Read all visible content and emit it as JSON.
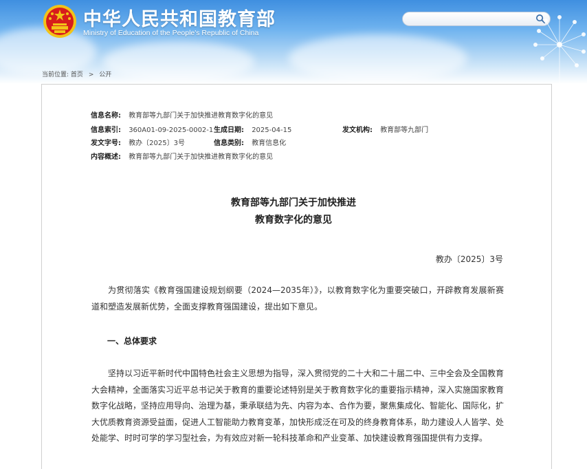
{
  "header": {
    "site_title": "中华人民共和国教育部",
    "site_subtitle": "Ministry of Education of the People's Republic of China",
    "search_placeholder": "",
    "colors": {
      "sky_top": "#3f8fe0",
      "sky_bottom": "#ffffff",
      "emblem_red": "#d71c1c",
      "emblem_gold": "#f2c318"
    },
    "icons": {
      "emblem": "national-emblem-icon",
      "search": "search-icon"
    }
  },
  "breadcrumb": {
    "prefix": "当前位置:",
    "items": [
      "首页",
      "公开"
    ],
    "separator": ">"
  },
  "meta": {
    "name_label": "信息名称:",
    "name_value": "教育部等九部门关于加快推进教育数字化的意见",
    "index_label": "信息索引:",
    "index_value": "360A01-09-2025-0002-1",
    "date_label": "生成日期:",
    "date_value": "2025-04-15",
    "org_label": "发文机构:",
    "org_value": "教育部等九部门",
    "docno_label": "发文字号:",
    "docno_value": "教办〔2025〕3号",
    "category_label": "信息类别:",
    "category_value": "教育信息化",
    "summary_label": "内容概述:",
    "summary_value": "教育部等九部门关于加快推进教育数字化的意见"
  },
  "document": {
    "title_line1": "教育部等九部门关于加快推进",
    "title_line2": "教育数字化的意见",
    "doc_number": "教办〔2025〕3号",
    "intro_paragraph": "为贯彻落实《教育强国建设规划纲要（2024—2035年）》，以教育数字化为重要突破口，开辟教育发展新赛道和塑造发展新优势，全面支撑教育强国建设，提出如下意见。",
    "section1_heading": "一、总体要求",
    "section1_paragraph": "坚持以习近平新时代中国特色社会主义思想为指导，深入贯彻党的二十大和二十届二中、三中全会及全国教育大会精神，全面落实习近平总书记关于教育的重要论述特别是关于教育数字化的重要指示精神，深入实施国家教育数字化战略，坚持应用导向、治理为基，秉承联结为先、内容为本、合作为要，聚焦集成化、智能化、国际化，扩大优质教育资源受益面，促进人工智能助力教育变革，加快形成泛在可及的终身教育体系，助力建设人人皆学、处处能学、时时可学的学习型社会，为有效应对新一轮科技革命和产业变革、加快建设教育强国提供有力支撑。"
  }
}
